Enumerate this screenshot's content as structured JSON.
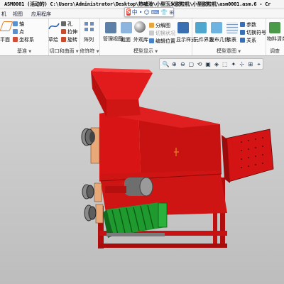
{
  "window": {
    "title": "ASM0001 (活动的) C:\\Users\\Administrator\\Desktop\\热嘘淦\\小型玉米脱粒机\\小型脱粒机\\asm0001.asm.6 - Cr"
  },
  "ime_toolbar": {
    "brand": "S",
    "glyphs": [
      "中",
      "•",
      "☺",
      "⌨",
      "👕",
      "⊞"
    ]
  },
  "menus": [
    {
      "label": "机"
    },
    {
      "label": "视图"
    },
    {
      "label": "应用程序"
    }
  ],
  "ribbon": {
    "groups": [
      {
        "label": "基准",
        "items": [
          {
            "label": "平面"
          },
          {
            "label": "轴"
          },
          {
            "label": "点"
          },
          {
            "label": "坐标系"
          }
        ]
      },
      {
        "label": "切口和曲面",
        "items": [
          {
            "label": "草绘"
          },
          {
            "label": "孔"
          },
          {
            "label": "拉伸"
          },
          {
            "label": "旋转"
          }
        ]
      },
      {
        "label": "修饰符",
        "items": [
          {
            "label": "阵列"
          }
        ]
      },
      {
        "label": "模型显示",
        "items": [
          {
            "label": "管理视图"
          },
          {
            "label": "截面"
          },
          {
            "label": "外观库"
          },
          {
            "label": "分解图"
          },
          {
            "label": "切换状况"
          },
          {
            "label": "编辑位置"
          },
          {
            "label": "显示样式"
          }
        ]
      },
      {
        "label": "模型意图",
        "items": [
          {
            "label": "元件界面"
          },
          {
            "label": "发布几何"
          },
          {
            "label": "族表"
          },
          {
            "label": "参数"
          },
          {
            "label": "切换符号"
          },
          {
            "label": "关系"
          }
        ]
      },
      {
        "label": "调查",
        "items": [
          {
            "label": "物料清单"
          }
        ]
      }
    ]
  },
  "graphics_toolbar": {
    "icons": [
      "🔍",
      "⊕",
      "⊖",
      "▢",
      "⟲",
      "▣",
      "◈",
      "⬚",
      "✦",
      "⊹",
      "⊞",
      "⌖"
    ]
  },
  "colors": {
    "machine": "#d81414",
    "motor": "#1f9a2f",
    "pulley": "#7a7a7a",
    "bracket": "#e8a878",
    "ribbon_bg": "#fbfbfb"
  }
}
